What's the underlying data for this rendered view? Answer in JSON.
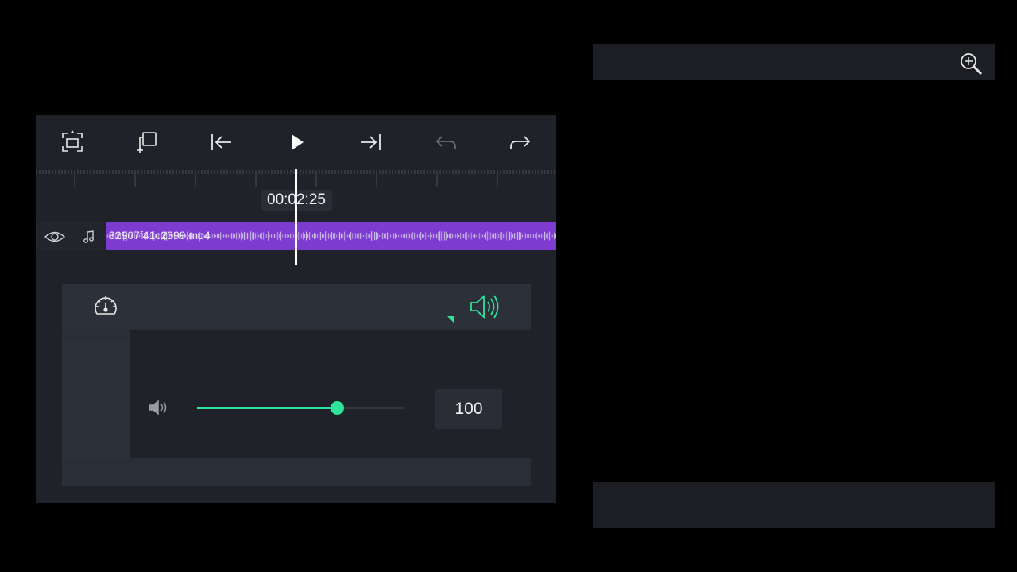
{
  "toolbar": {
    "icons": [
      "fullscreen-icon",
      "add-copy-icon",
      "skip-to-start-icon",
      "play-icon",
      "skip-to-end-icon",
      "undo-icon",
      "redo-icon"
    ],
    "undo_enabled": false
  },
  "timeline": {
    "current_time": "00:02:25",
    "playhead_fraction": 0.5,
    "clip": {
      "name": "32907f41c2399.mp4",
      "color": "#7e3bd0"
    }
  },
  "audio_panel": {
    "volume": 100,
    "volume_fraction": 0.67,
    "accent_color": "#2ee39b"
  },
  "colors": {
    "background": "#000000",
    "panel": "#1f2229",
    "accent": "#2ee39b"
  }
}
